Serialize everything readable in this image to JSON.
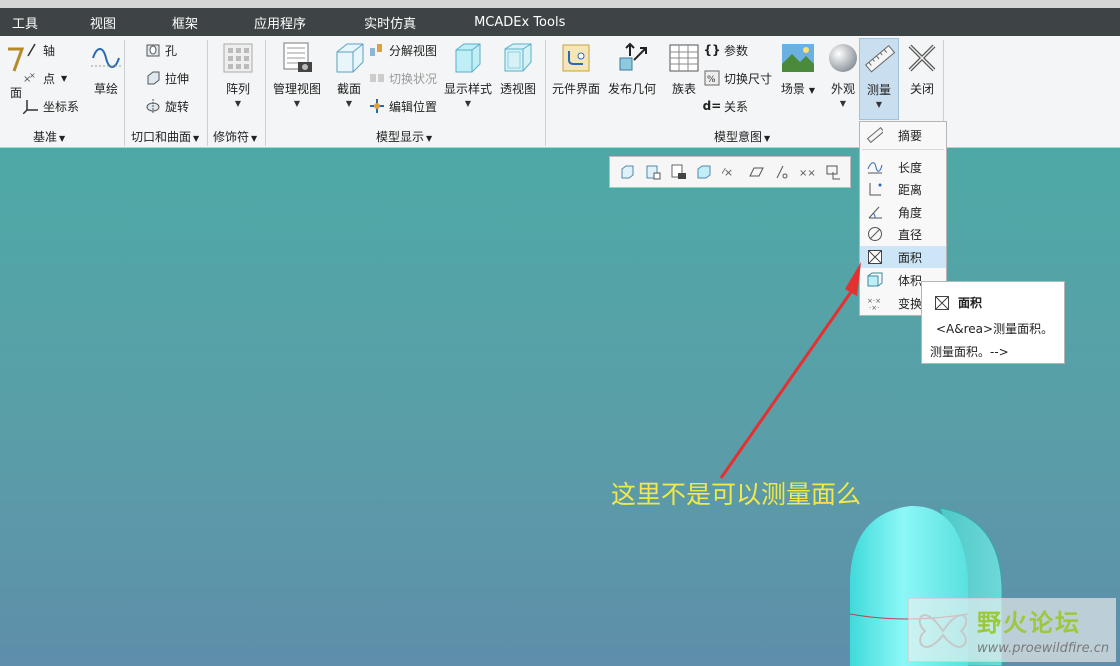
{
  "menu": [
    "工具",
    "视图",
    "框架",
    "应用程序",
    "实时仿真",
    "MCADEx Tools"
  ],
  "ribbon": {
    "datum": {
      "left_cut_label": "面",
      "axis": "轴",
      "point": "点",
      "csys": "坐标系",
      "sketch": "草绘",
      "group": "基准"
    },
    "cuts": {
      "hole": "孔",
      "extrude": "拉伸",
      "revolve": "旋转",
      "group": "切口和曲面"
    },
    "editing": {
      "pattern": "阵列",
      "group": "修饰符"
    },
    "model_display": {
      "manage_views": "管理视图",
      "section": "截面",
      "explode_view": "分解视图",
      "toggle_status": "切换状况",
      "edit_position": "编辑位置",
      "display_style": "显示样式",
      "perspective": "透视图",
      "group": "模型显示"
    },
    "model_intent": {
      "component_interface": "元件界面",
      "publish_geometry": "发布几何",
      "family_table": "族表",
      "parameters": "参数",
      "switch_dims": "切换尺寸",
      "relations": "关系",
      "scene": "场景",
      "appearance": "外观",
      "measure": "测量",
      "close": "关闭",
      "group": "模型意图"
    }
  },
  "measure_menu": [
    "摘要",
    "长度",
    "距离",
    "角度",
    "直径",
    "面积",
    "体积",
    "变换"
  ],
  "tooltip": {
    "title": "面积",
    "line1": "<A&rea>测量面积。",
    "line2": "测量面积。-->"
  },
  "annotation": "这里不是可以测量面么",
  "watermark": {
    "title": "野火论坛",
    "url": "www.proewildfire.cn"
  },
  "colors": {
    "menubar": "#3e4446",
    "annotation_text": "#f2e84a",
    "arrow": "#e53030",
    "part": "#6ef0f0"
  }
}
